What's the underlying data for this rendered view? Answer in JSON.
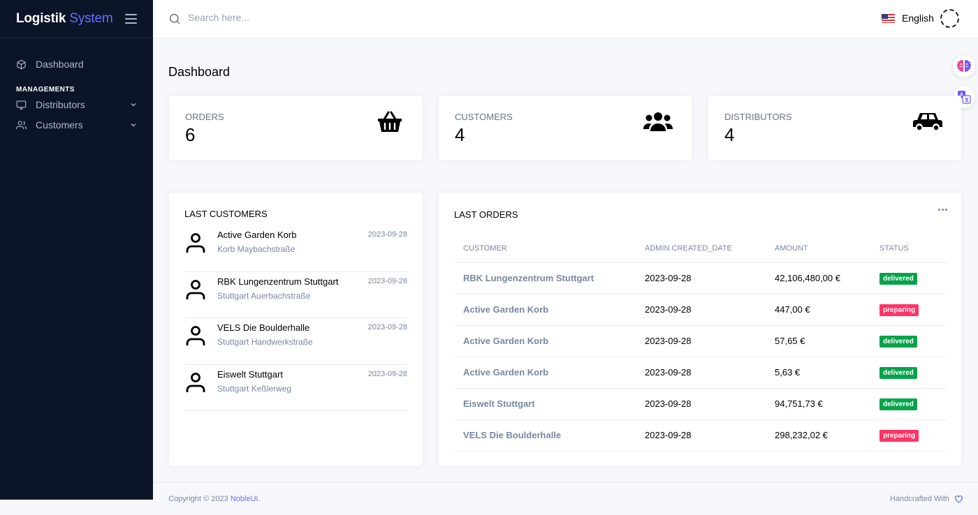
{
  "app": {
    "brand_main": "Logistik",
    "brand_accent": "System",
    "accent_color": "#6571ff",
    "sidebar_bg": "#0c1427"
  },
  "sidebar": {
    "dashboard_label": "Dashboard",
    "category": "MANAGEMENTS",
    "items": [
      {
        "label": "Distributors",
        "icon": "monitor-icon"
      },
      {
        "label": "Customers",
        "icon": "users-icon"
      }
    ]
  },
  "topbar": {
    "search_placeholder": "Search here...",
    "language": "English"
  },
  "page": {
    "title": "Dashboard"
  },
  "stats": [
    {
      "label": "ORDERS",
      "value": "6",
      "icon": "basket-icon"
    },
    {
      "label": "CUSTOMERS",
      "value": "4",
      "icon": "users-group-icon"
    },
    {
      "label": "DISTRIBUTORS",
      "value": "4",
      "icon": "car-icon"
    }
  ],
  "last_customers": {
    "title": "LAST CUSTOMERS",
    "items": [
      {
        "name": "Active Garden Korb",
        "address": "Korb Maybachstraße",
        "date": "2023-09-28"
      },
      {
        "name": "RBK Lungenzentrum Stuttgart",
        "address": "Stuttgart Auerbachstraße",
        "date": "2023-09-28"
      },
      {
        "name": "VELS Die Boulderhalle",
        "address": "Stuttgart Handwerkstraße",
        "date": "2023-09-28"
      },
      {
        "name": "Eiswelt Stuttgart",
        "address": "Stuttgart Keßlerweg",
        "date": "2023-09-28"
      }
    ]
  },
  "last_orders": {
    "title": "LAST ORDERS",
    "columns": [
      "CUSTOMER",
      "ADMIN.CREATED_DATE",
      "AMOUNT",
      "STATUS"
    ],
    "rows": [
      {
        "customer": "RBK Lungenzentrum Stuttgart",
        "date": "2023-09-28",
        "amount": "42,106,480,00 €",
        "status": "delivered"
      },
      {
        "customer": "Active Garden Korb",
        "date": "2023-09-28",
        "amount": "447,00 €",
        "status": "preparing"
      },
      {
        "customer": "Active Garden Korb",
        "date": "2023-09-28",
        "amount": "57,65 €",
        "status": "delivered"
      },
      {
        "customer": "Active Garden Korb",
        "date": "2023-09-28",
        "amount": "5,63 €",
        "status": "delivered"
      },
      {
        "customer": "Eiswelt Stuttgart",
        "date": "2023-09-28",
        "amount": "94,751,73 €",
        "status": "delivered"
      },
      {
        "customer": "VELS Die Boulderhalle",
        "date": "2023-09-28",
        "amount": "298,232,02 €",
        "status": "preparing"
      }
    ],
    "status_colors": {
      "delivered": "#05a34a",
      "preparing": "#ff3366"
    }
  },
  "footer": {
    "copyright": "Copyright © 2023",
    "link": "NobleUI",
    "period": ".",
    "handcrafted": "Handcrafted With"
  }
}
